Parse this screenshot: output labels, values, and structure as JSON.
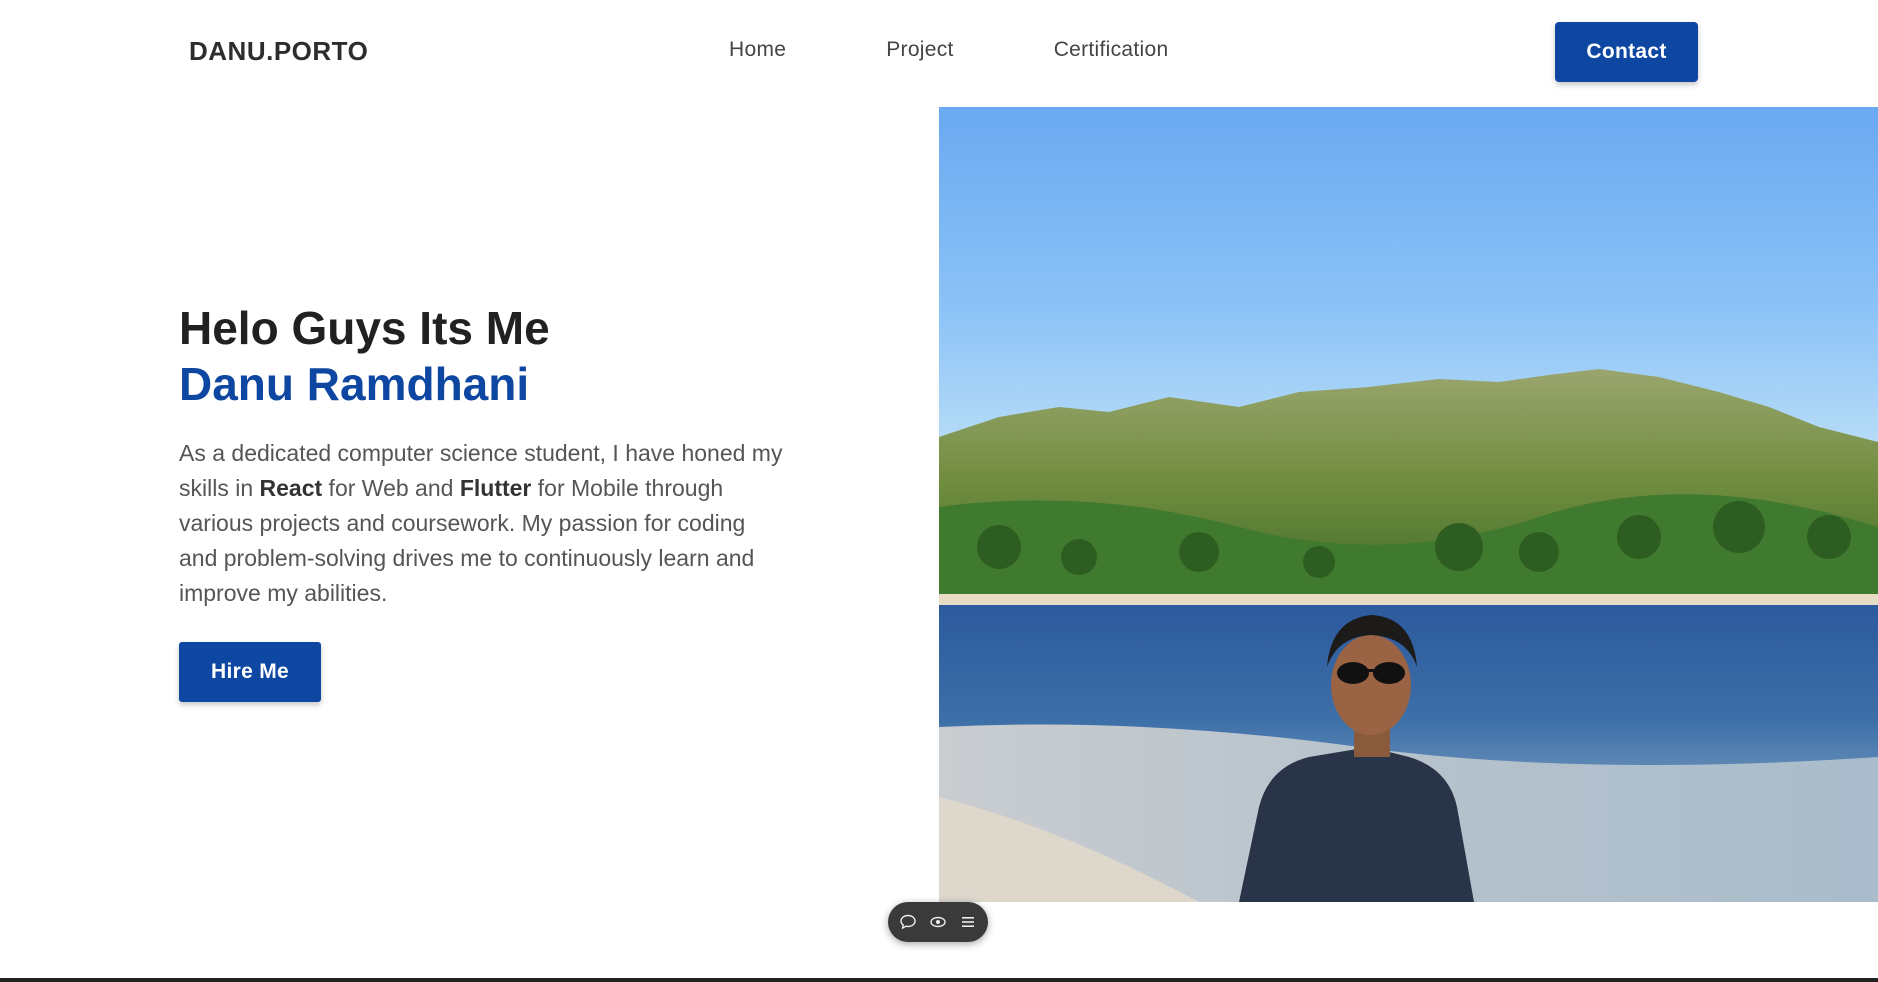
{
  "brand": "DANU.PORTO",
  "nav": {
    "links": [
      "Home",
      "Project",
      "Certification"
    ],
    "contact_label": "Contact"
  },
  "hero": {
    "greeting": "Helo Guys Its Me",
    "name": "Danu Ramdhani",
    "desc_part1": "As a dedicated computer science student, I have honed my skills in ",
    "skill1": "React",
    "desc_part2": " for Web and ",
    "skill2": "Flutter",
    "desc_part3": " for Mobile through various projects and coursework. My passion for coding and problem-solving drives me to continuously learn and improve my abilities.",
    "hire_label": "Hire Me"
  },
  "toolbar": {
    "icons": [
      "comment-icon",
      "eye-icon",
      "menu-icon"
    ]
  },
  "colors": {
    "primary": "#0d47a1",
    "heading": "#212121",
    "text": "#555555"
  }
}
